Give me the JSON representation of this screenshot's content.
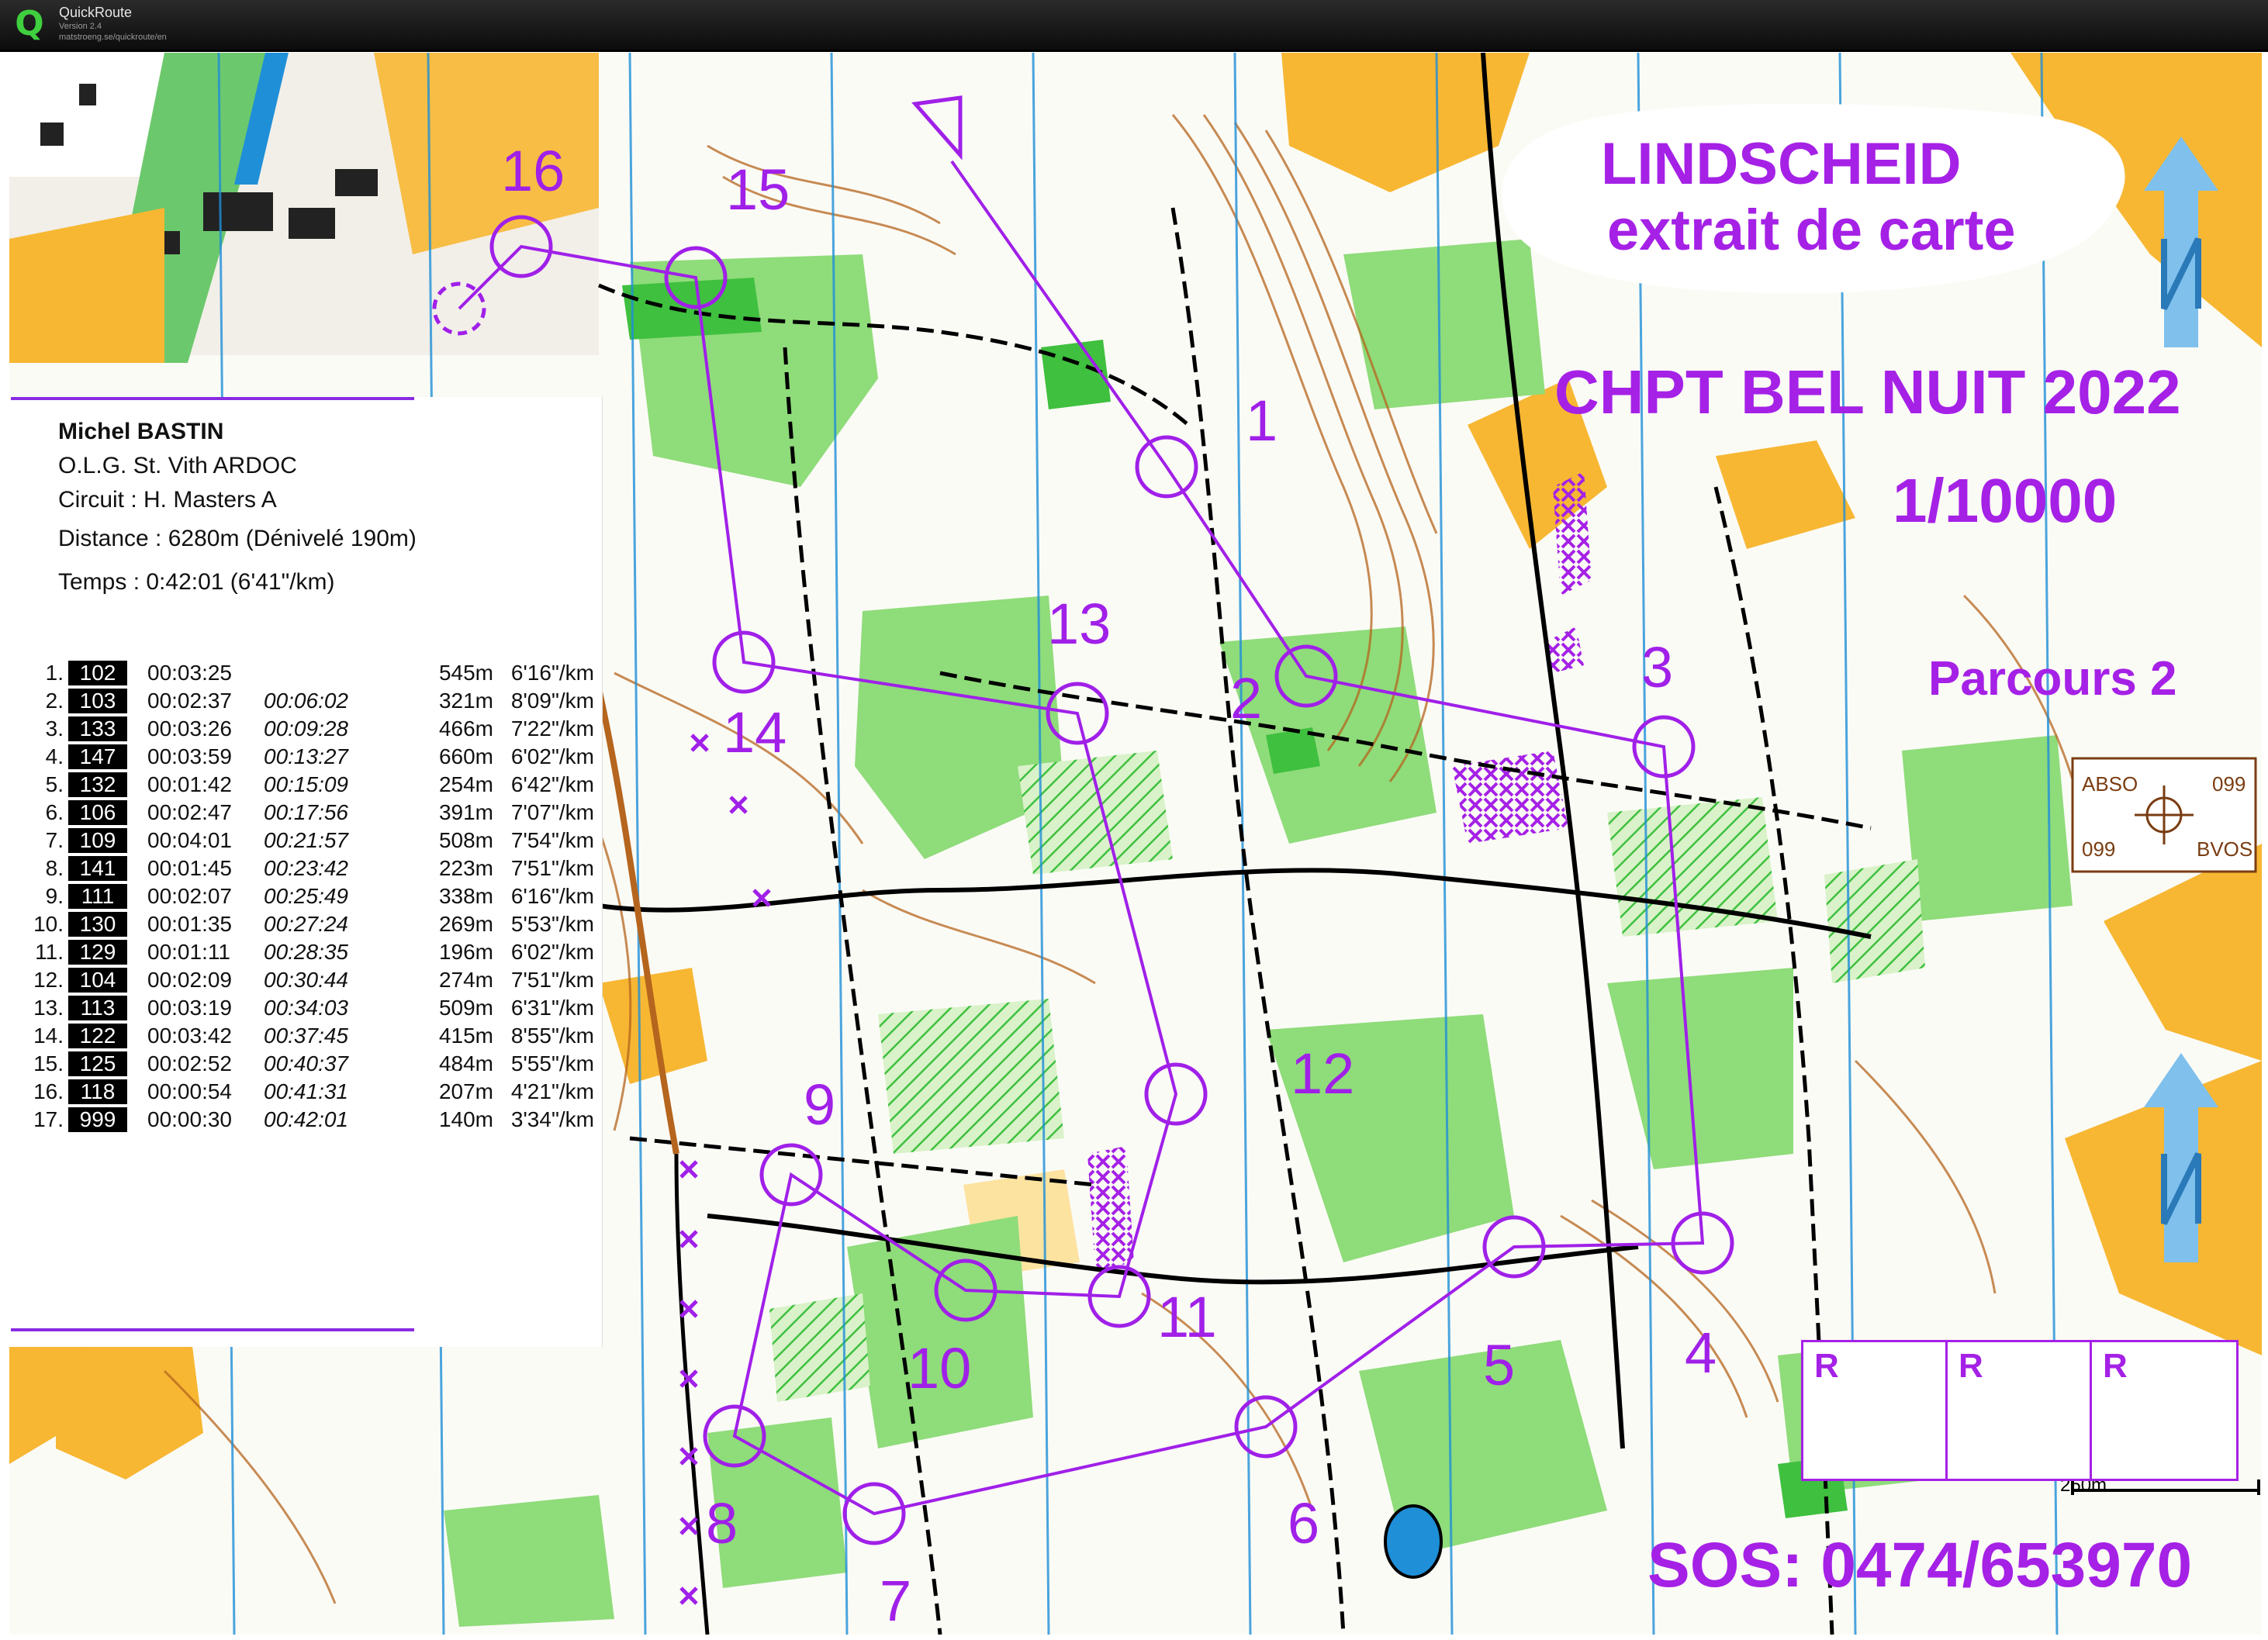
{
  "app": {
    "title": "QuickRoute",
    "version": "Version 2.4",
    "url": "matstroeng.se/quickroute/en",
    "icon": "quickroute-q-icon"
  },
  "map": {
    "title_line1": "LINDSCHEID",
    "title_line2": "extrait de carte",
    "event": "CHPT BEL NUIT 2022",
    "scale": "1/10000",
    "course": "Parcours 2",
    "sos": "SOS: 0474/653970",
    "scale_bar": "250m",
    "symbol_box": {
      "top_left": "ABSO",
      "top_right": "099",
      "bottom_left": "099",
      "bottom_right": "BVOS"
    },
    "clue_boxes": [
      "R",
      "R",
      "R"
    ],
    "north_arrows": [
      "north-arrow-icon",
      "north-arrow-icon"
    ],
    "control_numbers": [
      "1",
      "2",
      "3",
      "4",
      "5",
      "6",
      "7",
      "8",
      "9",
      "10",
      "11",
      "12",
      "13",
      "14",
      "15",
      "16"
    ],
    "colors": {
      "course": "#a020e8",
      "open": "#f7b733",
      "forest": "#3fc03f",
      "contours": "#b5651d"
    }
  },
  "runner": {
    "name": "Michel BASTIN",
    "club": "O.L.G. St. Vith ARDOC",
    "circuit": "Circuit : H. Masters A",
    "distance": "Distance : 6280m (Dénivelé 190m)",
    "time": "Temps : 0:42:01 (6'41\"/km)"
  },
  "splits": [
    {
      "idx": "1.",
      "code": "102",
      "split": "00:03:25",
      "cum": "",
      "dist": "545m",
      "pace": "6'16\"/km"
    },
    {
      "idx": "2.",
      "code": "103",
      "split": "00:02:37",
      "cum": "00:06:02",
      "dist": "321m",
      "pace": "8'09\"/km"
    },
    {
      "idx": "3.",
      "code": "133",
      "split": "00:03:26",
      "cum": "00:09:28",
      "dist": "466m",
      "pace": "7'22\"/km"
    },
    {
      "idx": "4.",
      "code": "147",
      "split": "00:03:59",
      "cum": "00:13:27",
      "dist": "660m",
      "pace": "6'02\"/km"
    },
    {
      "idx": "5.",
      "code": "132",
      "split": "00:01:42",
      "cum": "00:15:09",
      "dist": "254m",
      "pace": "6'42\"/km"
    },
    {
      "idx": "6.",
      "code": "106",
      "split": "00:02:47",
      "cum": "00:17:56",
      "dist": "391m",
      "pace": "7'07\"/km"
    },
    {
      "idx": "7.",
      "code": "109",
      "split": "00:04:01",
      "cum": "00:21:57",
      "dist": "508m",
      "pace": "7'54\"/km"
    },
    {
      "idx": "8.",
      "code": "141",
      "split": "00:01:45",
      "cum": "00:23:42",
      "dist": "223m",
      "pace": "7'51\"/km"
    },
    {
      "idx": "9.",
      "code": "111",
      "split": "00:02:07",
      "cum": "00:25:49",
      "dist": "338m",
      "pace": "6'16\"/km"
    },
    {
      "idx": "10.",
      "code": "130",
      "split": "00:01:35",
      "cum": "00:27:24",
      "dist": "269m",
      "pace": "5'53\"/km"
    },
    {
      "idx": "11.",
      "code": "129",
      "split": "00:01:11",
      "cum": "00:28:35",
      "dist": "196m",
      "pace": "6'02\"/km"
    },
    {
      "idx": "12.",
      "code": "104",
      "split": "00:02:09",
      "cum": "00:30:44",
      "dist": "274m",
      "pace": "7'51\"/km"
    },
    {
      "idx": "13.",
      "code": "113",
      "split": "00:03:19",
      "cum": "00:34:03",
      "dist": "509m",
      "pace": "6'31\"/km"
    },
    {
      "idx": "14.",
      "code": "122",
      "split": "00:03:42",
      "cum": "00:37:45",
      "dist": "415m",
      "pace": "8'55\"/km"
    },
    {
      "idx": "15.",
      "code": "125",
      "split": "00:02:52",
      "cum": "00:40:37",
      "dist": "484m",
      "pace": "5'55\"/km"
    },
    {
      "idx": "16.",
      "code": "118",
      "split": "00:00:54",
      "cum": "00:41:31",
      "dist": "207m",
      "pace": "4'21\"/km"
    },
    {
      "idx": "17.",
      "code": "999",
      "split": "00:00:30",
      "cum": "00:42:01",
      "dist": "140m",
      "pace": "3'34\"/km"
    }
  ]
}
